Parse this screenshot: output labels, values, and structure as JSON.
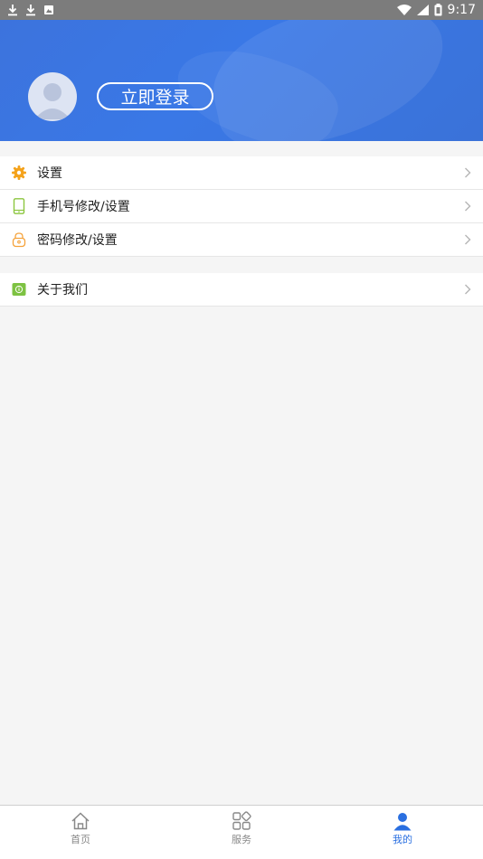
{
  "status_bar": {
    "time": "9:17",
    "left_icons": [
      "download-icon",
      "download-icon",
      "image-icon"
    ],
    "right_icons": [
      "wifi-icon",
      "signal-icon",
      "battery-icon"
    ]
  },
  "header": {
    "login_label": "立即登录",
    "avatar": "user-avatar-icon"
  },
  "menu_group_1": {
    "items": [
      {
        "label": "设置",
        "icon": "gear-icon",
        "icon_color": "#f4a21b"
      },
      {
        "label": "手机号修改/设置",
        "icon": "phone-icon",
        "icon_color": "#8cc63f"
      },
      {
        "label": "密码修改/设置",
        "icon": "lock-icon",
        "icon_color": "#f5a23a"
      }
    ]
  },
  "menu_group_2": {
    "items": [
      {
        "label": "关于我们",
        "icon": "info-icon",
        "icon_color": "#7dc242"
      }
    ]
  },
  "tab_bar": {
    "tabs": [
      {
        "label": "首页",
        "icon": "home-icon",
        "active": false
      },
      {
        "label": "服务",
        "icon": "services-grid-icon",
        "active": false
      },
      {
        "label": "我的",
        "icon": "profile-icon",
        "active": true
      }
    ],
    "active_color": "#2a6fe0",
    "inactive_color": "#888888"
  }
}
